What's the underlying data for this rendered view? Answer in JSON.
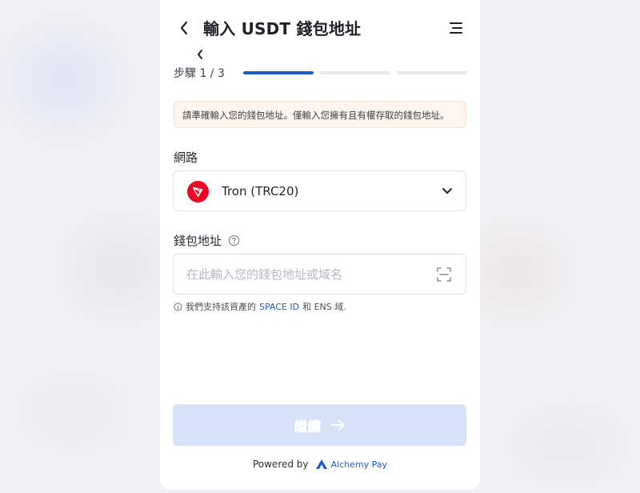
{
  "header": {
    "title": "輸入 USDT 錢包地址"
  },
  "steps": {
    "label": "步驟 1 / 3",
    "current": 1,
    "total": 3
  },
  "notice": {
    "text": "請準確輸入您的錢包地址。僅輸入您擁有且有權存取的錢包地址。"
  },
  "network": {
    "label": "網路",
    "selected": "Tron (TRC20)",
    "icon": "tron-icon"
  },
  "wallet": {
    "label": "錢包地址",
    "value": "",
    "placeholder": "在此輸入您的錢包地址或域名"
  },
  "hint": {
    "prefix": "我們支持該資產的",
    "link": "SPACE ID",
    "suffix": "和 ENS 域."
  },
  "actions": {
    "continue_label": "繼續"
  },
  "footer": {
    "powered_by": "Powered by",
    "brand": "Alchemy Pay"
  },
  "colors": {
    "accent": "#1f5bc6",
    "button_disabled": "#d6e2f7",
    "notice_bg": "#fdf4ee",
    "tron_red": "#ec0623"
  }
}
